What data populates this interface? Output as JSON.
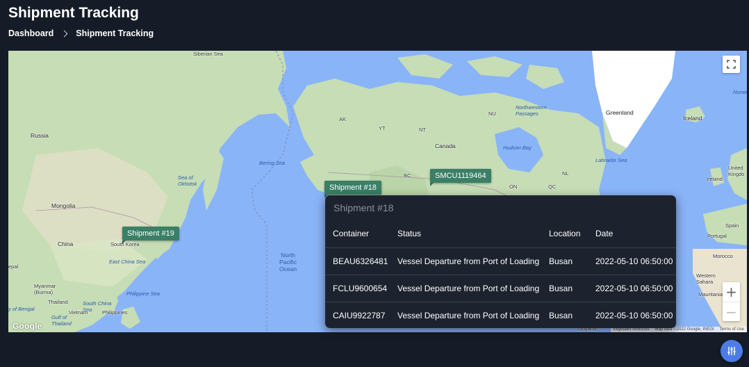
{
  "page": {
    "title": "Shipment Tracking",
    "breadcrumb": [
      "Dashboard",
      "Shipment Tracking"
    ]
  },
  "map": {
    "labels": {
      "siberian_sea": "Siberian Sea",
      "russia": "Russia",
      "mongolia": "Mongolia",
      "china": "China",
      "south_korea": "South Korea",
      "sea_of_okhotsk": "Sea of\nOkhotsk",
      "bering_sea": "Bering Sea",
      "east_china_sea": "East China Sea",
      "philippine_sea": "Philippine Sea",
      "myanmar": "Myanmar\n(Burma)",
      "thailand": "Thailand",
      "south_china_sea": "South China\nSea",
      "vietnam": "Vietnam",
      "philippines": "Philippines",
      "bay_of_bengal": "y of Bengal",
      "gulf_of_thailand": "Gulf of\nThailand",
      "nepal": "epal",
      "north_pacific_ocean": "North\nPacific\nOcean",
      "canada": "Canada",
      "hudson_bay": "Hudson Bay",
      "ak": "AK",
      "yt": "YT",
      "nt": "NT",
      "nu": "NU",
      "bc": "BC",
      "on": "ON",
      "qc": "QC",
      "nl": "NL",
      "northwestern_passages": "Northwestern\nPassages",
      "labrador_sea": "Labrador Sea",
      "greenland": "Greenland",
      "iceland": "Iceland",
      "norway_edge": "Norwe",
      "united_kingdom": "United\nKingdo",
      "ireland": "Ireland",
      "spain": "Spain",
      "portugal": "Portugal",
      "morocco": "Morocco",
      "western_sahara": "Western\nSahara",
      "mauritania": "Mauritania",
      "guyana": "Guyana"
    },
    "markers": {
      "shipment_19": "Shipment #19",
      "shipment_18": "Shipment #18",
      "smcu": "SMCU1119464"
    },
    "google": "Google",
    "attribution": [
      "Keyboard shortcuts",
      "Map data ©2022 Google, INEGI",
      "Terms of Use"
    ],
    "zoom_in": "+",
    "zoom_out": "−"
  },
  "popup": {
    "title": "Shipment #18",
    "columns": [
      "Container",
      "Status",
      "Location",
      "Date"
    ],
    "rows": [
      [
        "BEAU6326481",
        "Vessel Departure from Port of Loading",
        "Busan",
        "2022-05-10 06:50:00"
      ],
      [
        "FCLU9600654",
        "Vessel Departure from Port of Loading",
        "Busan",
        "2022-05-10 06:50:00"
      ],
      [
        "CAIU9922787",
        "Vessel Departure from Port of Loading",
        "Busan",
        "2022-05-10 06:50:00"
      ]
    ]
  },
  "colors": {
    "background": "#161c27",
    "ocean": "#8ab4f8",
    "land": "#c8dfbd",
    "marker": "#3a7f66",
    "popup": "#1d232e",
    "fab": "#4c7ce6"
  },
  "icons": {
    "fullscreen": "fullscreen-icon",
    "fab": "sliders-icon",
    "breadcrumb_separator": "chevron-right-icon"
  }
}
